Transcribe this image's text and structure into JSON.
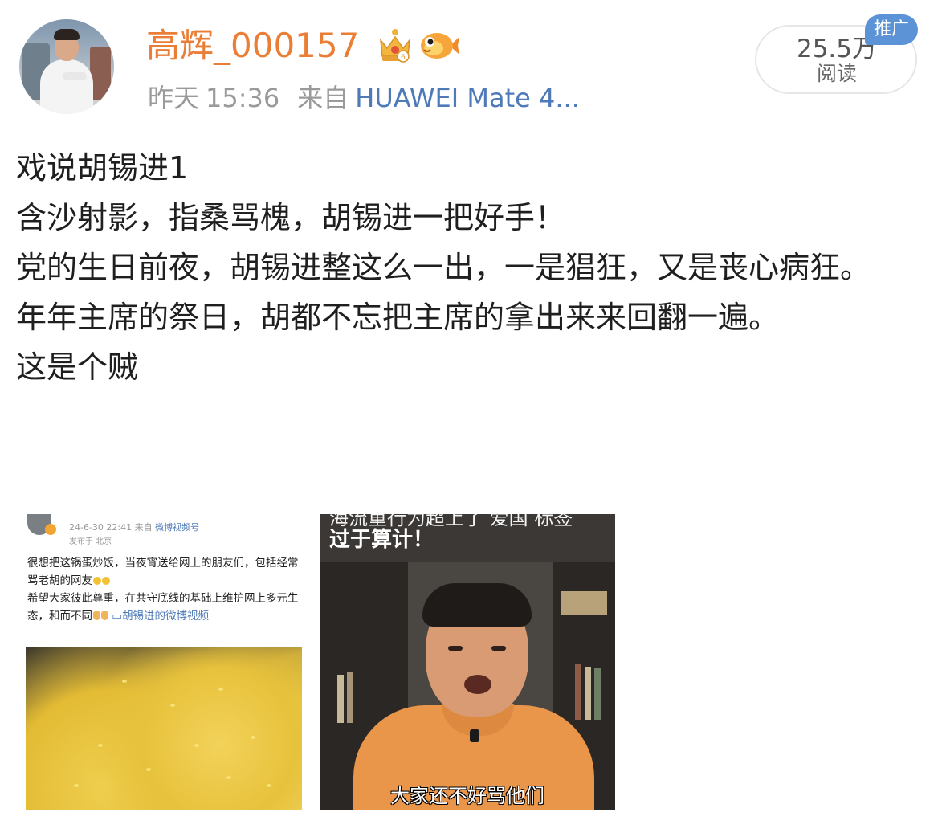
{
  "header": {
    "username": "高辉_000157",
    "badges": [
      "crown-vip-icon",
      "fish-icon"
    ],
    "timestamp_day": "昨天",
    "timestamp_time": "15:36",
    "source_prefix": "来自",
    "source_device": "HUAWEI Mate 4...",
    "reads_count": "25.5万",
    "reads_label": "阅读",
    "promo_badge": "推广"
  },
  "post": {
    "lines": [
      "戏说胡锡进1",
      "含沙射影，指桑骂槐，胡锡进一把好手！",
      "党的生日前夜，胡锡进整这么一出，一是猖狂，又是丧心病狂。",
      "年年主席的祭日，胡都不忘把主席的拿出来来回翻一遍。",
      "这是个贼"
    ]
  },
  "images": {
    "left": {
      "meta_time": "24-6-30 22:41",
      "meta_from": "来自",
      "meta_source": "微博视频号",
      "location": "发布于 北京",
      "text_line1": "很想把这锅蛋炒饭，当夜宵送给网上的朋友们，包括经常骂老胡的网友",
      "text_line2": "希望大家彼此尊重，在共守底线的基础上维护网上多元生态，和而不同",
      "link_text": "胡锡进的微博视频"
    },
    "right": {
      "top_caption_cut": "海流重行为超上了 爱国 标签",
      "top_caption": "过于算计！",
      "bottom_caption": "大家还不好骂他们"
    }
  },
  "colors": {
    "username": "#eb7e36",
    "meta_gray": "#9a9a9a",
    "link_blue": "#4e7ab8",
    "promo_blue": "#5b93d6",
    "text": "#1f1f1f"
  }
}
